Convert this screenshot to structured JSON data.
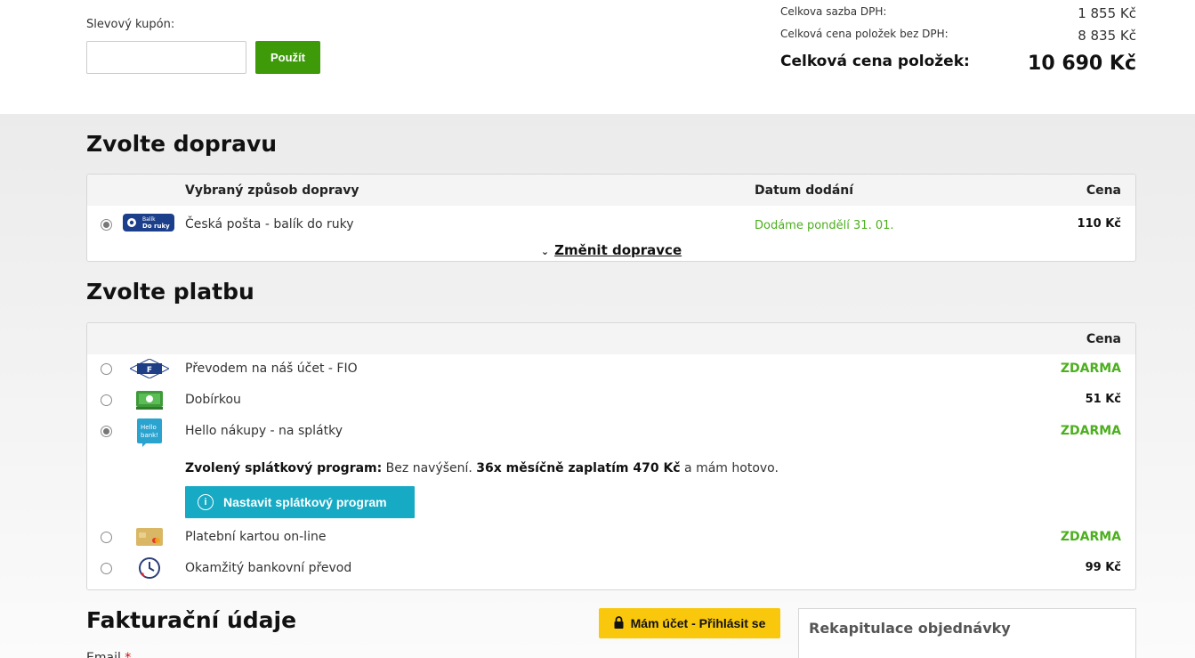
{
  "coupon": {
    "label": "Slevový kupón:",
    "input_value": "",
    "button": "Použít"
  },
  "summary": {
    "vat_label": "Celkova sazba DPH:",
    "vat_value": "1 855 Kč",
    "net_label": "Celková cena položek bez DPH:",
    "net_value": "8 835 Kč",
    "total_label": "Celková cena položek:",
    "total_value": "10 690 Kč"
  },
  "shipping": {
    "title": "Zvolte dopravu",
    "headers": {
      "method": "Vybraný způsob dopravy",
      "date": "Datum dodání",
      "price": "Cena"
    },
    "selected": {
      "name": "Česká pošta - balík do ruky",
      "date": "Dodáme pondělí 31. 01.",
      "price": "110 Kč",
      "logo_line1": "Balík",
      "logo_line2": "Do ruky"
    },
    "change_link": "Změnit dopravce"
  },
  "payment": {
    "title": "Zvolte platbu",
    "price_header": "Cena",
    "options": [
      {
        "name": "Převodem na náš účet - FIO",
        "price": "ZDARMA",
        "icon": "fio-logo-icon"
      },
      {
        "name": "Dobírkou",
        "price": "51 Kč",
        "icon": "cash-icon"
      },
      {
        "name": "Hello nákupy - na splátky",
        "price": "ZDARMA",
        "icon": "hello-bank-icon",
        "icon_text": "Hello bank!"
      },
      {
        "name": "Platební kartou on-line",
        "price": "ZDARMA",
        "icon": "credit-card-icon"
      },
      {
        "name": "Okamžitý bankovní převod",
        "price": "99 Kč",
        "icon": "instant-transfer-icon"
      }
    ],
    "installment": {
      "label": "Zvolený splátkový program:",
      "text1": " Bez navýšení. ",
      "bold": "36x měsíčně zaplatím 470 Kč",
      "text2": " a mám hotovo."
    },
    "installment_button": "Nastavit splátkový program"
  },
  "billing": {
    "title": "Fakturační údaje",
    "login_button": "Mám účet - Přihlásit se",
    "email_label": "Email",
    "required_mark": "*"
  },
  "recap": {
    "title": "Rekapitulace objednávky"
  }
}
